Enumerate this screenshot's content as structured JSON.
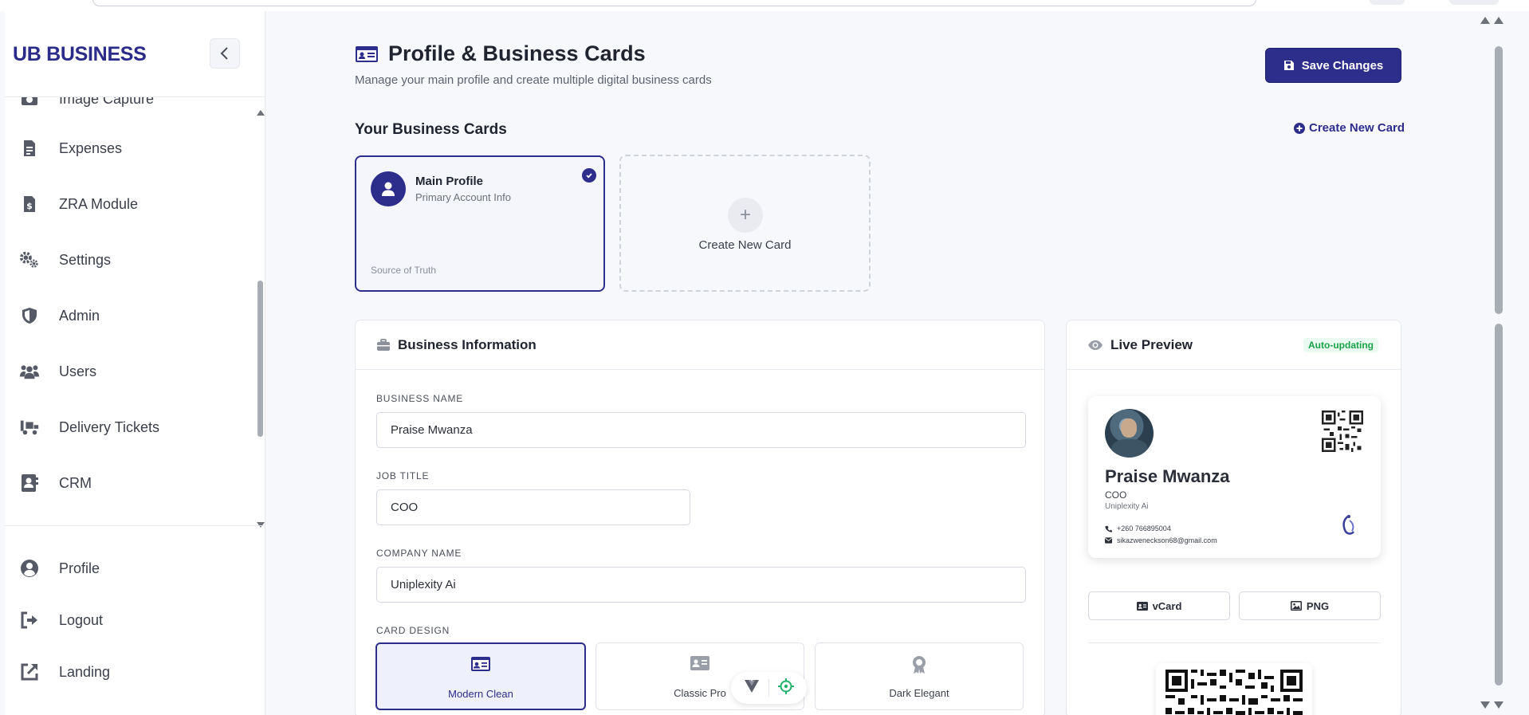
{
  "app": {
    "brand": "UB BUSINESS"
  },
  "sidebar": {
    "items": [
      {
        "label": "Image Capture",
        "icon": "camera-icon"
      },
      {
        "label": "Expenses",
        "icon": "receipt-icon"
      },
      {
        "label": "ZRA Module",
        "icon": "tax-file-icon"
      },
      {
        "label": "Settings",
        "icon": "gears-icon"
      },
      {
        "label": "Admin",
        "icon": "shield-icon"
      },
      {
        "label": "Users",
        "icon": "users-icon"
      },
      {
        "label": "Delivery Tickets",
        "icon": "truck-icon"
      },
      {
        "label": "CRM",
        "icon": "contact-card-icon"
      }
    ],
    "bottom_items": [
      {
        "label": "Profile",
        "icon": "user-circle-icon"
      },
      {
        "label": "Logout",
        "icon": "logout-icon"
      },
      {
        "label": "Landing",
        "icon": "external-link-icon"
      }
    ]
  },
  "header": {
    "title": "Profile & Business Cards",
    "subtitle": "Manage your main profile and create multiple digital business cards",
    "save_label": "Save Changes"
  },
  "cards_section": {
    "title": "Your Business Cards",
    "create_link": "Create New Card",
    "main_card": {
      "name": "Main Profile",
      "subtitle": "Primary Account Info",
      "footer": "Source of Truth"
    },
    "new_card_label": "Create New Card"
  },
  "business_info": {
    "title": "Business Information",
    "fields": {
      "business_name_label": "BUSINESS NAME",
      "business_name_value": "Praise Mwanza",
      "job_title_label": "JOB TITLE",
      "job_title_value": "COO",
      "company_name_label": "COMPANY NAME",
      "company_name_value": "Uniplexity Ai"
    },
    "card_design_label": "CARD DESIGN",
    "designs": [
      {
        "label": "Modern Clean",
        "selected": true
      },
      {
        "label": "Classic Pro",
        "selected": false
      },
      {
        "label": "Dark Elegant",
        "selected": false
      }
    ]
  },
  "preview": {
    "title": "Live Preview",
    "badge": "Auto-updating",
    "card": {
      "name": "Praise Mwanza",
      "role": "COO",
      "company": "Uniplexity Ai",
      "phone": "+260 766895004",
      "email": "sikazweneckson68@gmail.com"
    },
    "buttons": {
      "vcard": "vCard",
      "png": "PNG"
    }
  },
  "colors": {
    "accent": "#2d2d8c",
    "success": "#1aa34a",
    "background": "#f7f8fb"
  }
}
